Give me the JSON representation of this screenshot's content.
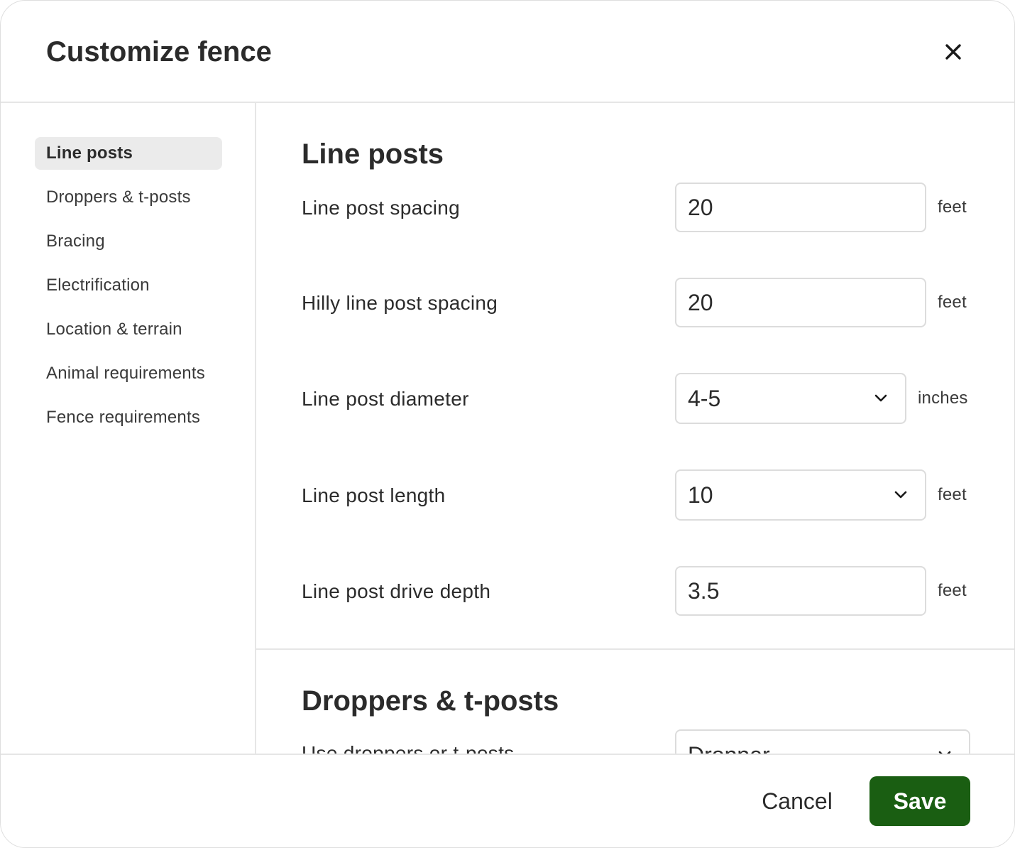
{
  "header": {
    "title": "Customize fence"
  },
  "sidebar": {
    "items": [
      {
        "label": "Line posts",
        "active": true
      },
      {
        "label": "Droppers & t-posts",
        "active": false
      },
      {
        "label": "Bracing",
        "active": false
      },
      {
        "label": "Electrification",
        "active": false
      },
      {
        "label": "Location & terrain",
        "active": false
      },
      {
        "label": "Animal requirements",
        "active": false
      },
      {
        "label": "Fence requirements",
        "active": false
      }
    ]
  },
  "sections": {
    "line_posts": {
      "title": "Line posts",
      "fields": [
        {
          "label": "Line post spacing",
          "value": "20",
          "unit": "feet",
          "type": "input"
        },
        {
          "label": "Hilly line post spacing",
          "value": "20",
          "unit": "feet",
          "type": "input"
        },
        {
          "label": "Line post diameter",
          "value": "4-5",
          "unit": "inches",
          "type": "select"
        },
        {
          "label": "Line post length",
          "value": "10",
          "unit": "feet",
          "type": "select"
        },
        {
          "label": "Line post drive depth",
          "value": "3.5",
          "unit": "feet",
          "type": "input"
        }
      ]
    },
    "droppers": {
      "title": "Droppers & t-posts",
      "fields": [
        {
          "label": "Use droppers or t-posts",
          "value": "Dropper",
          "type": "select"
        }
      ]
    }
  },
  "footer": {
    "cancel_label": "Cancel",
    "save_label": "Save"
  },
  "colors": {
    "primary": "#1a5e12",
    "active_nav_bg": "#ebebeb",
    "border": "#dcdcdc"
  },
  "icons": {
    "close": "close-icon",
    "chevron": "chevron-down-icon"
  }
}
